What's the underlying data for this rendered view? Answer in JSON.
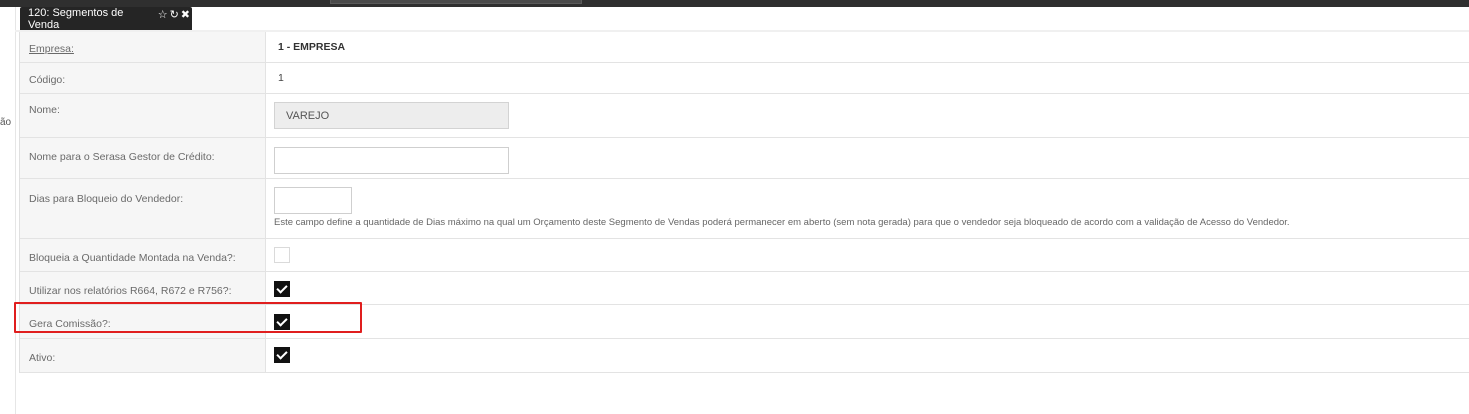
{
  "colors": {
    "highlight": "#e01e1e",
    "tab_bg": "#252525",
    "checkbox_on": "#111111"
  },
  "tab": {
    "title": "120: Segmentos de Venda",
    "icons": [
      "star-icon",
      "refresh-icon",
      "close-icon"
    ]
  },
  "left_gutter": {
    "cut_text": "ão"
  },
  "form": {
    "empresa": {
      "label": "Empresa:",
      "value": "1 - EMPRESA"
    },
    "codigo": {
      "label": "Código:",
      "value": "1"
    },
    "nome": {
      "label": "Nome:",
      "value": "VAREJO"
    },
    "nome_serasa": {
      "label": "Nome para o Serasa Gestor de Crédito:",
      "value": ""
    },
    "dias_bloqueio": {
      "label": "Dias para Bloqueio do Vendedor:",
      "value": "",
      "help": "Este campo define a quantidade de Dias máximo na qual um Orçamento deste Segmento de Vendas poderá permanecer em aberto (sem nota gerada) para que o vendedor seja bloqueado de acordo com a validação de Acesso do Vendedor."
    },
    "bloqueia_qtd": {
      "label": "Bloqueia a Quantidade Montada na Venda?:",
      "checked": false
    },
    "utilizar_relatorios": {
      "label": "Utilizar nos relatórios R664, R672 e R756?:",
      "checked": true
    },
    "gera_comissao": {
      "label": "Gera Comissão?:",
      "checked": true
    },
    "ativo": {
      "label": "Ativo:",
      "checked": true
    }
  }
}
